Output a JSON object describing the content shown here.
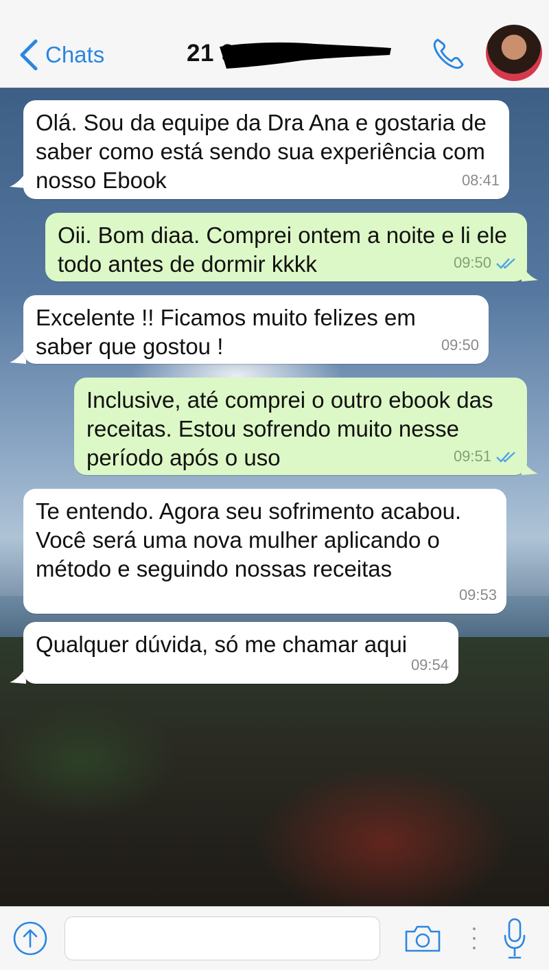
{
  "header": {
    "back_label": "Chats",
    "contact_name": "21 9",
    "back_icon": "chevron-left-icon",
    "call_icon": "phone-icon"
  },
  "messages": [
    {
      "direction": "in",
      "text": "Olá. Sou da equipe da Dra Ana e gostaria de saber como está sendo sua experiência com nosso Ebook",
      "time": "08:41"
    },
    {
      "direction": "out",
      "text": "Oii. Bom diaa. Comprei ontem a noite e li ele todo antes de dormir kkkk",
      "time": "09:50",
      "status": "read"
    },
    {
      "direction": "in",
      "text": "Excelente !! Ficamos muito felizes em saber que gostou !",
      "time": "09:50"
    },
    {
      "direction": "out",
      "text": "Inclusive, até comprei o outro ebook das receitas. Estou sofrendo muito nesse período após o uso",
      "time": "09:51",
      "status": "read"
    },
    {
      "direction": "in",
      "text": "Te entendo. Agora seu sofrimento acabou. Você será uma nova mulher aplicando o método e seguindo nossas receitas",
      "time": "09:53"
    },
    {
      "direction": "in",
      "text": "Qualquer dúvida, só me chamar aqui",
      "time": "09:54"
    }
  ],
  "input": {
    "placeholder": "",
    "value": ""
  },
  "colors": {
    "accent": "#2b86e0",
    "outgoing_bubble": "#dcf8c6",
    "incoming_bubble": "#ffffff",
    "read_ticks": "#4fa3e6"
  }
}
